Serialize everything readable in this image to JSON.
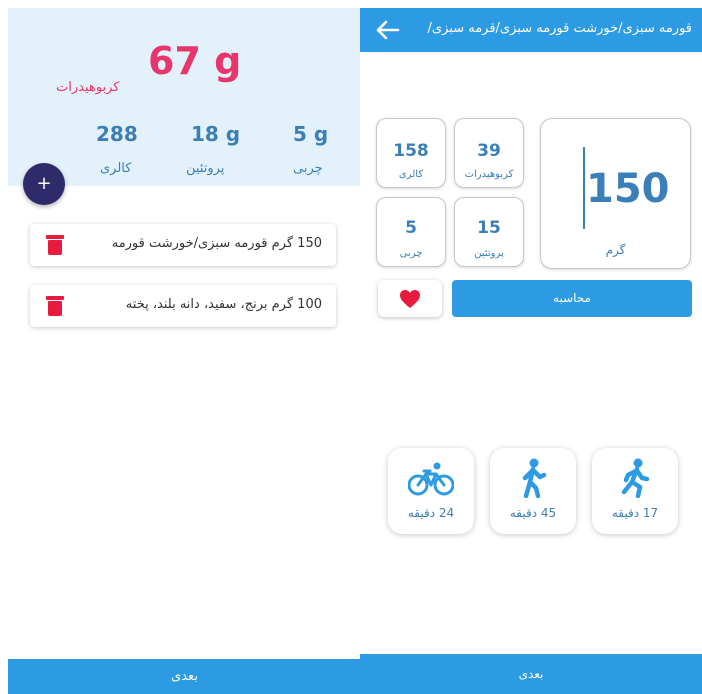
{
  "left_screen": {
    "summary": {
      "carbs_value": "67 g",
      "carbs_label": "کربوهیدرات",
      "stats": [
        {
          "value": "288",
          "label": "کالری"
        },
        {
          "value": "18 g",
          "label": "پروتئین"
        },
        {
          "value": "5 g",
          "label": "چربی"
        }
      ]
    },
    "add_label": "+",
    "food_items": [
      {
        "text": "150 گرم قورمه سبزی/خورشت قورمه"
      },
      {
        "text": "100 گرم برنج، سفید، دانه بلند، پخته"
      }
    ],
    "next_label": "بعدی"
  },
  "right_screen": {
    "title": "قورمه سبزی/خورشت قورمه سبزی/قرمه سبزی/",
    "nutrients": {
      "calories": {
        "value": "158",
        "label": "کالری"
      },
      "carbs": {
        "value": "39",
        "label": "کربوهیدرات"
      },
      "fat": {
        "value": "5",
        "label": "چربی"
      },
      "protein": {
        "value": "15",
        "label": "پروتئین"
      }
    },
    "gram": {
      "value": "150",
      "label": "گرم"
    },
    "calculate_label": "محاسبه",
    "activities": [
      {
        "icon": "bicycle-icon",
        "label": "24 دقیقه"
      },
      {
        "icon": "walking-icon",
        "label": "45 دقیقه"
      },
      {
        "icon": "running-icon",
        "label": "17 دقیقه"
      }
    ],
    "next_label": "بعدی"
  },
  "colors": {
    "accent": "#2c9be4",
    "carb_pink": "#e8356c",
    "stat_blue": "#3b7fb8",
    "delete_red": "#e81b3f",
    "add_button": "#2f2a6a",
    "summary_bg": "#e3f1fb"
  }
}
